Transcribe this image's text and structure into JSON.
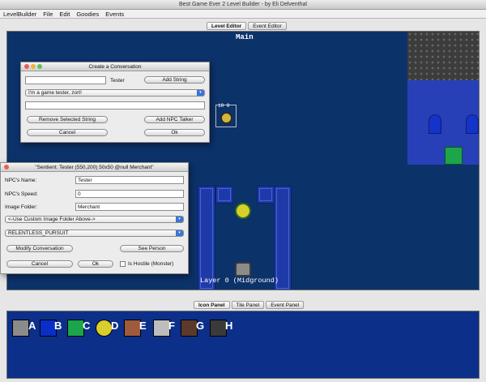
{
  "window": {
    "title": "Best Game Ever 2 Level Builder - by Eli Delventhal"
  },
  "menu": [
    "LevelBuilder",
    "File",
    "Edit",
    "Goodies",
    "Events"
  ],
  "editor_tabs": [
    "Level Editor",
    "Event Editor"
  ],
  "world": {
    "title": "Main",
    "layer_label": "Layer 0 (Midground)",
    "npc_tag": "18 9"
  },
  "conversation_dialog": {
    "title": "Create a Conversation",
    "string_input_value": "",
    "speaker_label": "Tester",
    "add_string_label": "Add String",
    "selected_string": "I'm a game tester, zort!",
    "second_input_value": "",
    "remove_label": "Remove Selected String",
    "add_npc_talker_label": "Add NPC Talker",
    "cancel_label": "Cancel",
    "ok_label": "Ok"
  },
  "npc_dialog": {
    "title": "\"Sentient: Tester (550,200) 50x50 @null Merchant\"",
    "name_label": "NPC's Name:",
    "name_value": "Tester",
    "speed_label": "NPC's Speed:",
    "speed_value": "0",
    "folder_label": "Image Folder:",
    "folder_value": "Merchant",
    "folder_select": "<-Use Custom Image Folder Above->",
    "behavior_select": "RELENTLESS_PURSUIT",
    "modify_label": "Modify Conversation",
    "see_person_label": "See Person",
    "cancel_label": "Cancel",
    "ok_label": "Ok",
    "hostile_label": "Is Hostile (Monster)",
    "hostile_checked": false
  },
  "panel_tabs": [
    "Icon Panel",
    "Tile Panel",
    "Event Panel"
  ],
  "palette": [
    "A",
    "B",
    "C",
    "D",
    "E",
    "F",
    "G",
    "H"
  ],
  "colors": {
    "world_bg": "#0c326a",
    "panel_bg": "#0c2f8a",
    "accent": "#3a74d6"
  }
}
